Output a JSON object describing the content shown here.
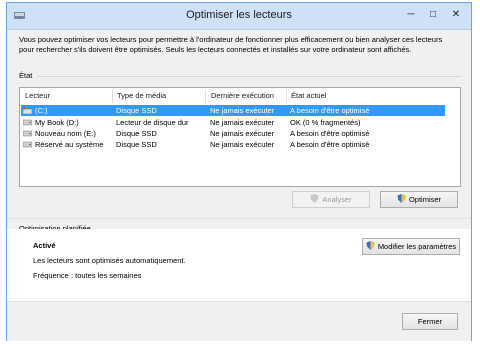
{
  "window": {
    "title": "Optimiser les lecteurs",
    "controls": {
      "minimize": "─",
      "maximize": "□",
      "close": "✕"
    }
  },
  "intro": "Vous pouvez optimiser vos lecteurs pour permettre à l'ordinateur de fonctionner plus efficacement ou bien analyser ces lecteurs pour rechercher s'ils doivent être optimisés. Seuls les lecteurs connectés et installés sur votre ordinateur sont affichés.",
  "status_section": {
    "label": "État"
  },
  "table": {
    "columns": [
      "Lecteur",
      "Type de média",
      "Dernière exécution",
      "État actuel"
    ],
    "rows": [
      {
        "drive": "(C:)",
        "media": "Disque SSD",
        "last_run": "Ne jamais exécuter",
        "state": "A besoin d'être optimisé",
        "selected": true,
        "icon": "windows-drive-icon"
      },
      {
        "drive": "My Book (D:)",
        "media": "Lecteur de disque dur",
        "last_run": "Ne jamais exécuter",
        "state": "OK (0 % fragmentés)",
        "selected": false,
        "icon": "hard-drive-icon"
      },
      {
        "drive": "Nouveau nom (E:)",
        "media": "Disque SSD",
        "last_run": "Ne jamais exécuter",
        "state": "A besoin d'être optimisé",
        "selected": false,
        "icon": "hard-drive-icon"
      },
      {
        "drive": "Réservé au système",
        "media": "Disque SSD",
        "last_run": "Ne jamais exécuter",
        "state": "A besoin d'être optimisé",
        "selected": false,
        "icon": "hard-drive-icon"
      }
    ]
  },
  "buttons": {
    "analyze": "Analyser",
    "optimize": "Optimiser",
    "change_settings": "Modifier les paramètres",
    "close": "Fermer"
  },
  "scheduled": {
    "label": "Optimisation planifiée",
    "status": "Activé",
    "description": "Les lecteurs sont optimisés automatiquement.",
    "frequency": "Fréquence : toutes les semaines"
  },
  "colors": {
    "selection": "#3399ff",
    "titlebar": "#cfe1f8",
    "border": "#6fa3e8"
  }
}
